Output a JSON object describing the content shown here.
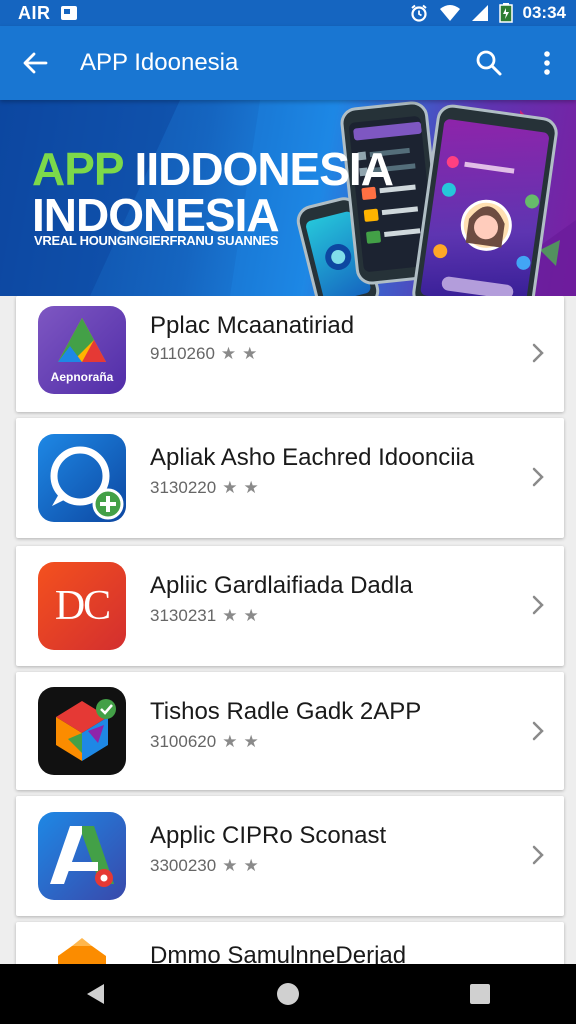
{
  "status_bar": {
    "carrier": "AIR",
    "time": "03:34",
    "icons": [
      "notification-icon",
      "alarm-icon",
      "wifi-icon",
      "signal-icon",
      "battery-icon"
    ]
  },
  "app_bar": {
    "title": "APP Idoonesia",
    "icons": [
      "back-arrow-icon",
      "search-icon",
      "more-vert-icon"
    ]
  },
  "banner": {
    "title_word1": "APP",
    "title_word2": "IIDDONESIA",
    "title_line2": "INDONESIA",
    "tagline": "VREAL HOUNGINGIERFRANU SUANNES"
  },
  "apps": [
    {
      "name": "Pplac Mcaanatiriad",
      "code": "9110260",
      "icon_label": "Aepnoraña",
      "icon": "triangle-logo-icon"
    },
    {
      "name": "Apliak Asho Eachred Idoonciia",
      "code": "3130220",
      "icon_label": "",
      "icon": "chat-bubble-plus-icon"
    },
    {
      "name": "Apliic Gardlaifiada Dadla",
      "code": "3130231",
      "icon_label": "DC",
      "icon": "dc-logo-icon"
    },
    {
      "name": "Tishos Radle Gadk 2APP",
      "code": "3100620",
      "icon_label": "",
      "icon": "colorful-cube-icon"
    },
    {
      "name": "Applic CIPRo Sconast",
      "code": "3300230",
      "icon_label": "",
      "icon": "letter-a-icon"
    },
    {
      "name": "Dmmo SamulnneDerjad",
      "code": "",
      "icon_label": "",
      "icon": "partial-app-icon"
    }
  ],
  "colors": {
    "status_bar": "#1565c0",
    "app_bar": "#1976d2",
    "banner_accent": "#7cd94a",
    "nav_bar": "#000000"
  }
}
